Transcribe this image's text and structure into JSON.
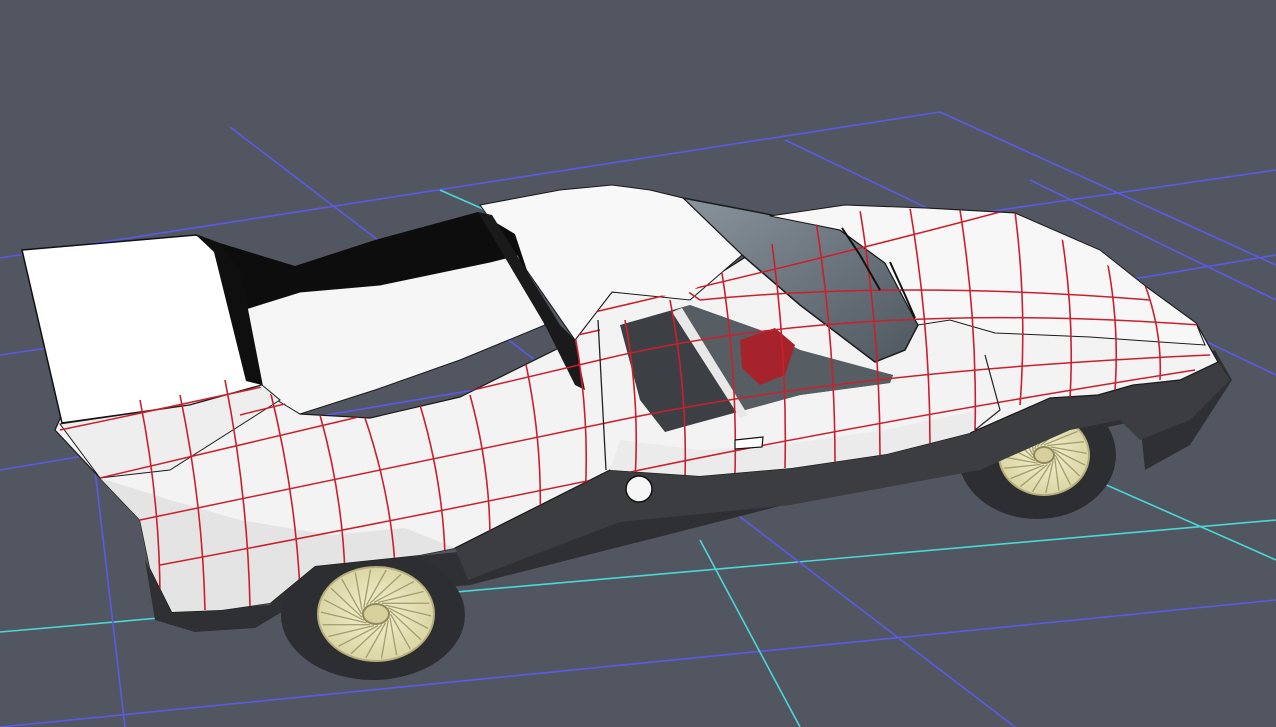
{
  "viewport": {
    "background_color": "#525660",
    "grid_color": "#5a5ae6",
    "axis_color": "#4ad8d8"
  },
  "model": {
    "body_color": "#ffffff",
    "uv_line_color": "#cc1f2d",
    "tire_color": "#2d2e31",
    "rim_color": "#e5e0b3",
    "trim_color": "#3c3d40",
    "glass_color": "#6d7680",
    "interior_color": "#a6232b",
    "icon": "car-model-icon"
  }
}
